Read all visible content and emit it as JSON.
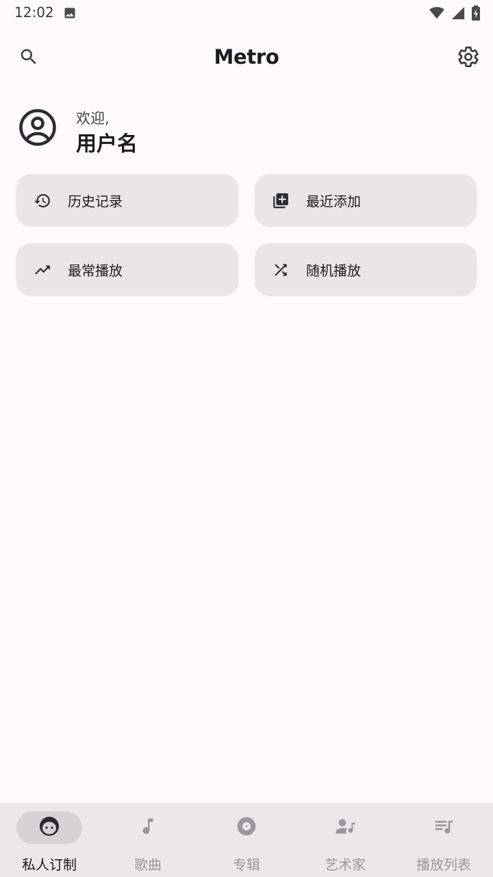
{
  "status": {
    "time": "12:02"
  },
  "header": {
    "title": "Metro"
  },
  "user": {
    "welcome": "欢迎,",
    "name": "用户名"
  },
  "quick_actions": [
    {
      "label": "历史记录",
      "icon": "history-icon"
    },
    {
      "label": "最近添加",
      "icon": "library-add-icon"
    },
    {
      "label": "最常播放",
      "icon": "trending-up-icon"
    },
    {
      "label": "随机播放",
      "icon": "shuffle-icon"
    }
  ],
  "bottom_nav": [
    {
      "label": "私人订制",
      "icon": "face-icon",
      "active": true
    },
    {
      "label": "歌曲",
      "icon": "music-note-icon",
      "active": false
    },
    {
      "label": "专辑",
      "icon": "album-icon",
      "active": false
    },
    {
      "label": "艺术家",
      "icon": "artist-icon",
      "active": false
    },
    {
      "label": "播放列表",
      "icon": "playlist-icon",
      "active": false
    }
  ],
  "colors": {
    "background": "#fdf9fc",
    "card": "#e9e5e8",
    "nav_bar": "#ebe7ea",
    "nav_active_pill": "#d6d2d6",
    "nav_inactive": "#9b979c",
    "text": "#1c1b1f"
  }
}
